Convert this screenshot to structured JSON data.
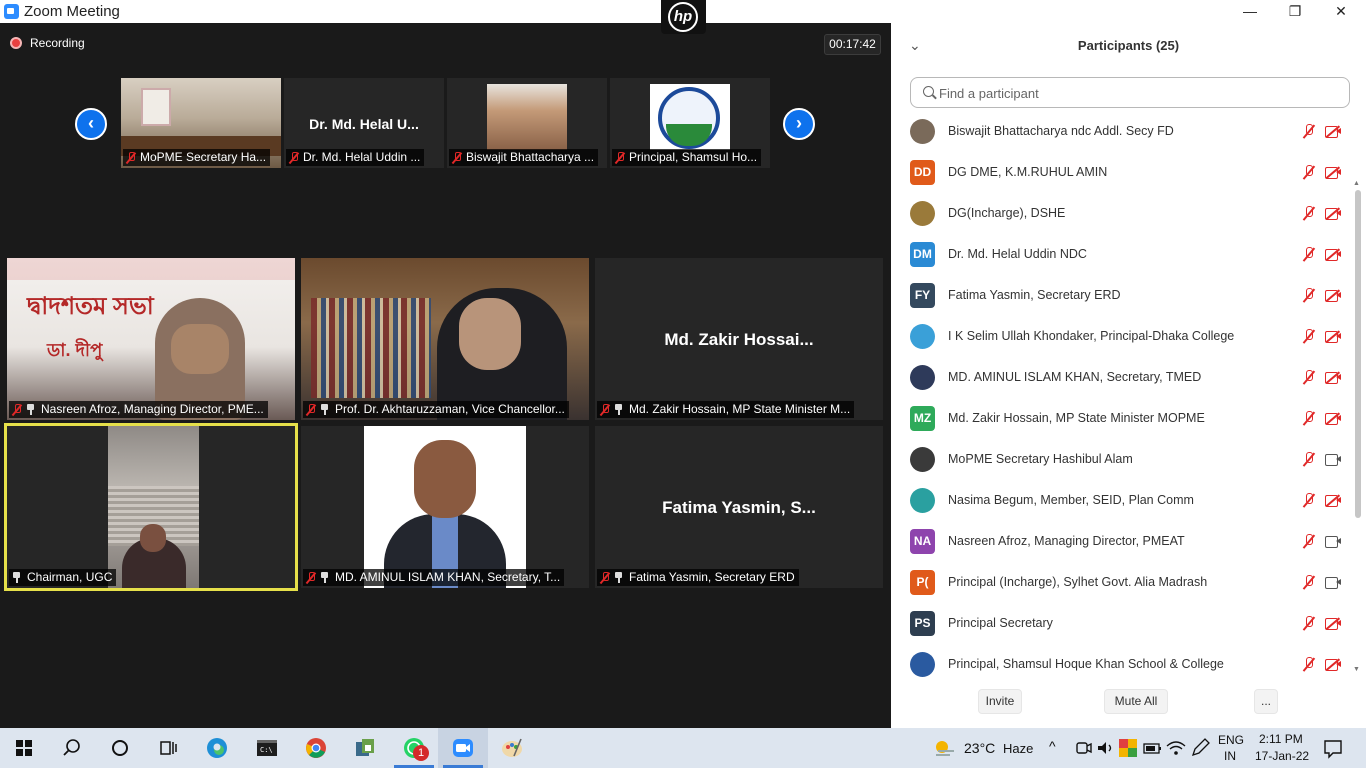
{
  "window": {
    "title": "Zoom Meeting",
    "minimize": "—",
    "maximize": "❐",
    "close": "✕"
  },
  "overlay": {
    "logo": "hp"
  },
  "meeting": {
    "recording_label": "Recording",
    "timer": "00:17:42",
    "strip_prev": "‹",
    "strip_next": "›",
    "thumbnails": [
      {
        "label": "MoPME Secretary Ha...",
        "name_overlay": ""
      },
      {
        "label": "Dr. Md. Helal Uddin ...",
        "name_overlay": "Dr. Md. Helal U..."
      },
      {
        "label": "Biswajit Bhattacharya ...",
        "name_overlay": ""
      },
      {
        "label": "Principal, Shamsul Ho...",
        "name_overlay": ""
      }
    ],
    "tiles": [
      {
        "label": "Nasreen Afroz, Managing Director, PME...",
        "name_overlay": "",
        "banner_text": "দ্বাদশতম সভা",
        "banner_sub": "ডা. দীপু"
      },
      {
        "label": "Prof. Dr. Akhtaruzzaman, Vice Chancellor...",
        "name_overlay": ""
      },
      {
        "label": "Md. Zakir Hossain, MP State Minister M...",
        "name_overlay": "Md. Zakir Hossai..."
      },
      {
        "label": "Chairman, UGC",
        "name_overlay": ""
      },
      {
        "label": "MD. AMINUL ISLAM KHAN, Secretary, T...",
        "name_overlay": ""
      },
      {
        "label": "Fatima Yasmin, Secretary ERD",
        "name_overlay": "Fatima Yasmin, S..."
      }
    ]
  },
  "participants": {
    "title": "Participants (25)",
    "collapse_icon": "⌄",
    "search_placeholder": "Find a participant",
    "list": [
      {
        "initials": "",
        "name": "Biswajit Bhattacharya ndc Addl. Secy FD",
        "avatar_color": "#7a6a5a",
        "cam_on": false
      },
      {
        "initials": "DD",
        "name": "DG DME, K.M.RUHUL AMIN",
        "avatar_color": "#e05a1a",
        "cam_on": false
      },
      {
        "initials": "",
        "name": "DG(Incharge), DSHE",
        "avatar_color": "#9a7a3a",
        "cam_on": false
      },
      {
        "initials": "DM",
        "name": "Dr. Md. Helal Uddin NDC",
        "avatar_color": "#2a8ad4",
        "cam_on": false
      },
      {
        "initials": "FY",
        "name": "Fatima Yasmin, Secretary ERD",
        "avatar_color": "#34495e",
        "cam_on": false
      },
      {
        "initials": "",
        "name": "I K Selim Ullah Khondaker, Principal-Dhaka College",
        "avatar_color": "#3aa0d8",
        "cam_on": false
      },
      {
        "initials": "",
        "name": "MD. AMINUL ISLAM KHAN, Secretary, TMED",
        "avatar_color": "#2e3a5a",
        "cam_on": false
      },
      {
        "initials": "MZ",
        "name": "Md. Zakir Hossain, MP State Minister MOPME",
        "avatar_color": "#2eaa5a",
        "cam_on": false
      },
      {
        "initials": "",
        "name": "MoPME Secretary Hashibul Alam",
        "avatar_color": "#3a3a3a",
        "cam_on": true
      },
      {
        "initials": "",
        "name": "Nasima Begum, Member, SEID, Plan Comm",
        "avatar_color": "#2aa0a0",
        "cam_on": false
      },
      {
        "initials": "NA",
        "name": "Nasreen Afroz, Managing Director, PMEAT",
        "avatar_color": "#8e44ad",
        "cam_on": true
      },
      {
        "initials": "P(",
        "name": "Principal (Incharge), Sylhet Govt. Alia Madrash",
        "avatar_color": "#e05a1a",
        "cam_on": true
      },
      {
        "initials": "PS",
        "name": "Principal Secretary",
        "avatar_color": "#2e3e50",
        "cam_on": false
      },
      {
        "initials": "",
        "name": "Principal, Shamsul Hoque Khan School & College",
        "avatar_color": "#2a5aa0",
        "cam_on": false
      }
    ],
    "invite_label": "Invite",
    "mute_all_label": "Mute All",
    "more_label": "..."
  },
  "taskbar": {
    "weather_temp": "23°C",
    "weather_text": "Haze",
    "lang_top": "ENG",
    "lang_bottom": "IN",
    "time": "2:11 PM",
    "date": "17-Jan-22",
    "whatsapp_badge": "1",
    "tray_chevron": "^",
    "icons": [
      "windows-start-icon",
      "search-icon",
      "cortana-icon",
      "task-view-icon",
      "edge-icon",
      "terminal-icon",
      "chrome-icon",
      "app-icon",
      "whatsapp-icon",
      "zoom-icon",
      "paint-icon"
    ]
  }
}
